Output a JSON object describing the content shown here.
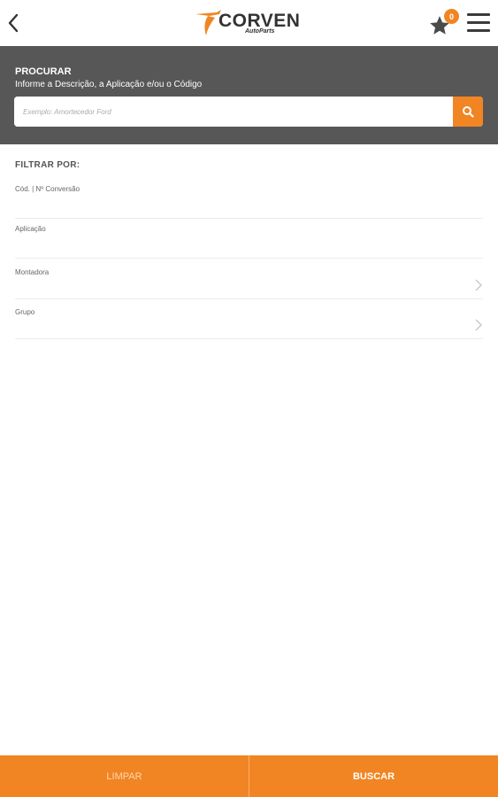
{
  "header": {
    "back_icon": "chevron-left-icon",
    "logo": {
      "name": "CORVEN",
      "subtitle": "AutoParts"
    },
    "favorites": {
      "icon": "star-icon",
      "count": "0"
    },
    "menu_icon": "hamburger-menu-icon"
  },
  "search": {
    "title": "PROCURAR",
    "subtitle": "Informe a Descrição, a Aplicação e/ou o Código",
    "placeholder": "Exemplo: Amortecedor Ford",
    "button_icon": "search-icon"
  },
  "filters": {
    "heading": "FILTRAR POR:",
    "items": [
      {
        "label": "Cód. | Nº Conversão",
        "has_chevron": false
      },
      {
        "label": "Aplicação",
        "has_chevron": false
      },
      {
        "label": "Montadora",
        "has_chevron": true
      },
      {
        "label": "Grupo",
        "has_chevron": true
      }
    ]
  },
  "actions": {
    "clear_label": "LIMPAR",
    "search_label": "BUSCAR"
  },
  "colors": {
    "accent": "#f18523",
    "panel": "#575757"
  }
}
